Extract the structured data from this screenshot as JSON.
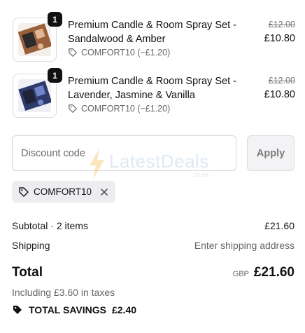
{
  "items": [
    {
      "quantity": "1",
      "title": "Premium Candle & Room Spray Set - Sandalwood & Amber",
      "discount_label": "COMFORT10 (−£1.20)",
      "original_price": "£12.00",
      "price": "£10.80",
      "image_colors": {
        "bg": "#9b5f3c",
        "box": "#2b2b2b",
        "accent": "#e1b896"
      },
      "image_icon": "candle-set-product-image"
    },
    {
      "quantity": "1",
      "title": "Premium Candle & Room Spray Set - Lavender, Jasmine & Vanilla",
      "discount_label": "COMFORT10 (−£1.20)",
      "original_price": "£12.00",
      "price": "£10.80",
      "image_colors": {
        "bg": "#2d3a6a",
        "box": "#1f2238",
        "accent": "#6e86c9"
      },
      "image_icon": "candle-set-product-image"
    }
  ],
  "discount": {
    "placeholder": "Discount code",
    "apply_label": "Apply",
    "applied_code": "COMFORT10"
  },
  "watermark": {
    "text": "LatestDeals",
    "sub": ".co.uk"
  },
  "summary": {
    "subtotal_label": "Subtotal · 2 items",
    "subtotal_value": "£21.60",
    "shipping_label": "Shipping",
    "shipping_value": "Enter shipping address",
    "total_label": "Total",
    "currency": "GBP",
    "total_value": "£21.60",
    "taxes_note": "Including £3.60 in taxes",
    "savings_label": "TOTAL SAVINGS",
    "savings_value": "£2.40"
  },
  "colors": {
    "text": "#111111",
    "muted": "#666666",
    "chip_bg": "#ececf1"
  }
}
